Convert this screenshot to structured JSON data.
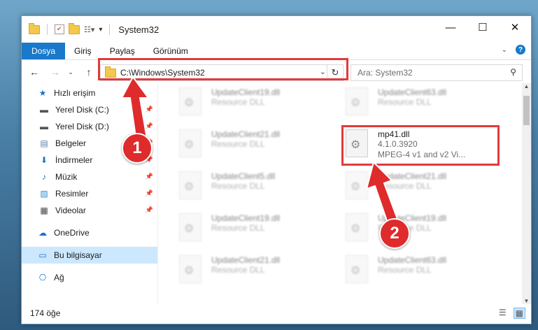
{
  "window": {
    "title": "System32"
  },
  "ribbon": {
    "tabs": [
      "Dosya",
      "Giriş",
      "Paylaş",
      "Görünüm"
    ]
  },
  "address": {
    "path": "C:\\Windows\\System32"
  },
  "search": {
    "placeholder": "Ara: System32"
  },
  "sidebar": {
    "items": [
      {
        "label": "Hızlı erişim",
        "icon": "star-icon"
      },
      {
        "label": "Yerel Disk (C:)",
        "icon": "drive-icon"
      },
      {
        "label": "Yerel Disk (D:)",
        "icon": "drive-icon"
      },
      {
        "label": "Belgeler",
        "icon": "document-icon"
      },
      {
        "label": "İndirmeler",
        "icon": "download-icon"
      },
      {
        "label": "Müzik",
        "icon": "music-icon"
      },
      {
        "label": "Resimler",
        "icon": "pictures-icon"
      },
      {
        "label": "Videolar",
        "icon": "video-icon"
      },
      {
        "label": "OneDrive",
        "icon": "cloud-icon"
      },
      {
        "label": "Bu bilgisayar",
        "icon": "computer-icon"
      },
      {
        "label": "Ağ",
        "icon": "network-icon"
      }
    ]
  },
  "files": {
    "left": [
      {
        "name": "UpdateClient19.dll",
        "type": "Resource DLL"
      },
      {
        "name": "UpdateClient21.dll",
        "type": "Resource DLL"
      },
      {
        "name": "UpdateClient5.dll",
        "type": "Resource DLL"
      },
      {
        "name": "UpdateClient19.dll",
        "type": "Resource DLL"
      },
      {
        "name": "UpdateClient21.dll",
        "type": "Resource DLL"
      }
    ],
    "right": [
      {
        "name": "UpdateClient63.dll",
        "type": "Resource DLL"
      },
      {
        "name": "UpdateClient21.dll",
        "type": "Resource DLL"
      },
      {
        "name": "UpdateClient19.dll",
        "type": "Resource DLL"
      },
      {
        "name": "UpdateClient63.dll",
        "type": "Resource DLL"
      }
    ],
    "highlight": {
      "name": "mp41.dll",
      "version": "4.1.0.3920",
      "description": "MPEG-4 v1 and v2 Vi..."
    }
  },
  "status": {
    "count": "174 öğe"
  },
  "annotations": {
    "badge1": "1",
    "badge2": "2",
    "color": "#e23b3b"
  }
}
